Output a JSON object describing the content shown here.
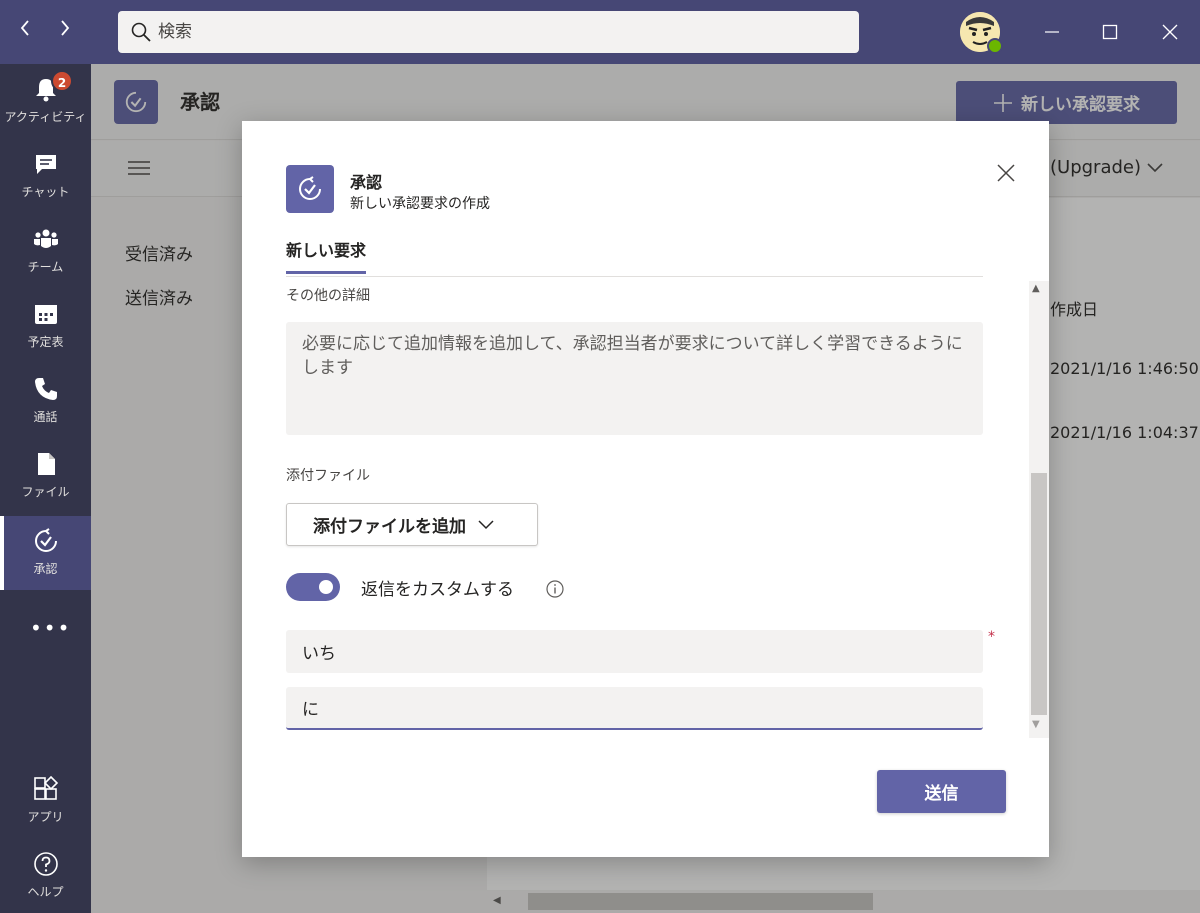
{
  "titlebar": {
    "search_placeholder": "検索",
    "back_icon": "chevron-left-icon",
    "forward_icon": "chevron-right-icon"
  },
  "rail": {
    "items": [
      {
        "label": "アクティビティ",
        "icon": "bell-icon",
        "badge": "2"
      },
      {
        "label": "チャット",
        "icon": "chat-icon"
      },
      {
        "label": "チーム",
        "icon": "teams-icon"
      },
      {
        "label": "予定表",
        "icon": "calendar-icon"
      },
      {
        "label": "通話",
        "icon": "phone-icon"
      },
      {
        "label": "ファイル",
        "icon": "file-icon"
      },
      {
        "label": "承認",
        "icon": "approvals-icon",
        "active": true
      },
      {
        "label": "アプリ",
        "icon": "apps-icon"
      },
      {
        "label": "ヘルプ",
        "icon": "help-icon"
      }
    ],
    "more": "•••"
  },
  "app": {
    "title": "承認",
    "new_request_label": "新しい承認要求",
    "plan_label": "(Upgrade)",
    "nav": [
      "受信済み",
      "送信済み"
    ],
    "column_header": "作成日",
    "rows": [
      "2021/1/16 1:46:50",
      "2021/1/16 1:04:37"
    ]
  },
  "dialog": {
    "title": "承認",
    "subtitle": "新しい承認要求の作成",
    "tab": "新しい要求",
    "details_label": "その他の詳細",
    "details_placeholder": "必要に応じて追加情報を追加して、承認担当者が要求について詳しく学習できるようにします",
    "attach_label": "添付ファイル",
    "attach_button": "添付ファイルを追加",
    "toggle_label": "返信をカスタムする",
    "toggle_on": true,
    "response_1": "いち",
    "response_2": "に",
    "required_mark": "*",
    "send_button": "送信"
  },
  "colors": {
    "brand": "#6264a7",
    "titlebar": "#464775",
    "rail": "#33344a",
    "badge": "#cc4a31",
    "status": "#6bb700"
  }
}
